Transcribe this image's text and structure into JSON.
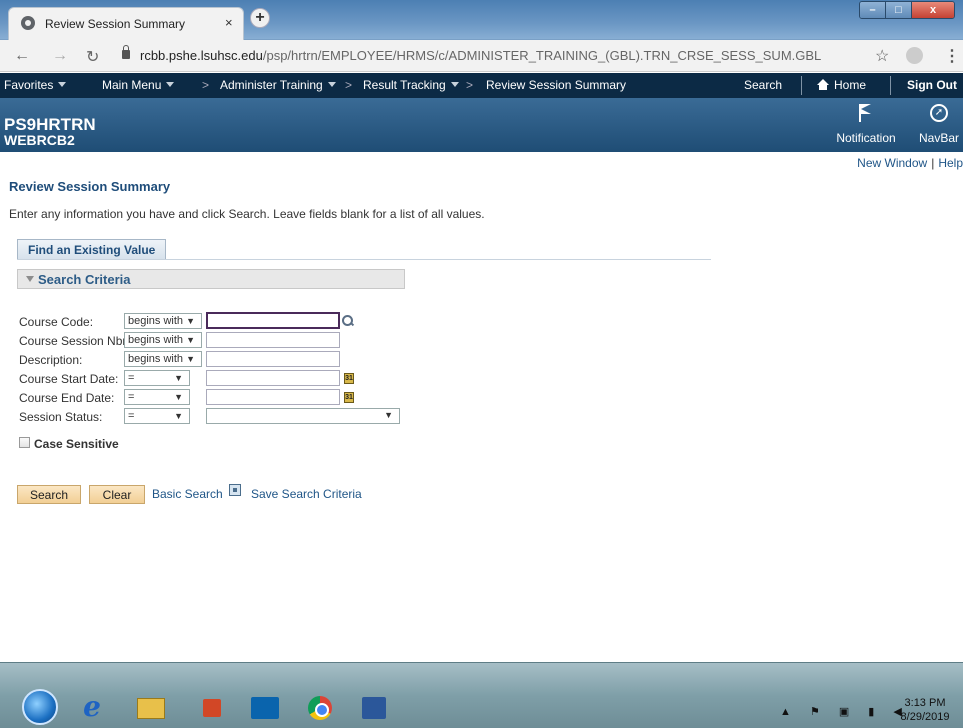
{
  "browser": {
    "tab_title": "Review Session Summary",
    "tab_close": "×",
    "new_tab": "+",
    "url_host": "rcbb.pshe.lsuhsc.edu",
    "url_path": "/psp/hrtrn/EMPLOYEE/HRMS/c/ADMINISTER_TRAINING_(GBL).TRN_CRSE_SESS_SUM.GBL",
    "window_buttons": {
      "minimize": "–",
      "maximize": "□",
      "close": "x"
    }
  },
  "navbar": {
    "favorites": "Favorites",
    "main_menu": "Main Menu",
    "breadcrumbs": [
      "Administer Training",
      "Result Tracking",
      "Review Session Summary"
    ],
    "search": "Search",
    "home": "Home",
    "sign_out": "Sign Out"
  },
  "banner": {
    "system_name": "PS9HRTRN",
    "database": "WEBRCB2",
    "notification": "Notification",
    "navbar": "NavBar"
  },
  "page": {
    "new_window": "New Window",
    "help": "Help",
    "title": "Review Session Summary",
    "instructions": "Enter any information you have and click Search. Leave fields blank for a list of all values.",
    "tab": "Find an Existing Value",
    "section": "Search Criteria",
    "fields": [
      {
        "label": "Course Code:",
        "operator": "begins with",
        "value": ""
      },
      {
        "label": "Course Session Nbr:",
        "operator": "begins with",
        "value": ""
      },
      {
        "label": "Description:",
        "operator": "begins with",
        "value": ""
      },
      {
        "label": "Course Start Date:",
        "operator": "=",
        "value": ""
      },
      {
        "label": "Course End Date:",
        "operator": "=",
        "value": ""
      },
      {
        "label": "Session Status:",
        "operator": "=",
        "value": ""
      }
    ],
    "case_sensitive": "Case Sensitive",
    "search_button": "Search",
    "clear_button": "Clear",
    "basic_search": "Basic Search",
    "save_search": "Save Search Criteria",
    "calendar_glyph": "31"
  },
  "taskbar": {
    "time": "3:13 PM",
    "date": "8/29/2019",
    "ie_glyph": "e"
  }
}
